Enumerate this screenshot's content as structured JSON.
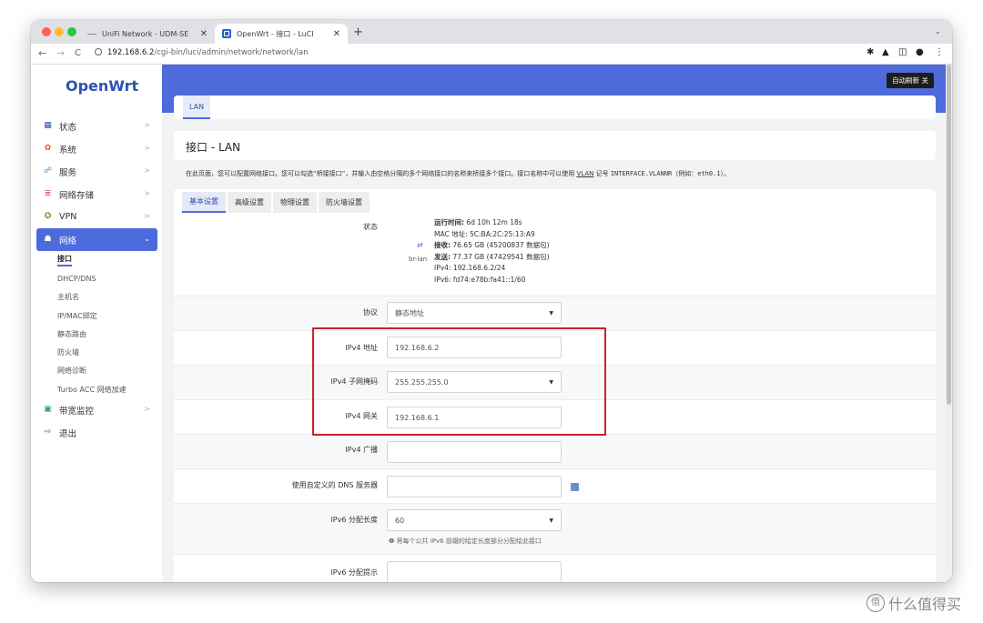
{
  "browser": {
    "tabs": [
      {
        "label": "UniFi Network - UDM-SE",
        "close": "✕"
      },
      {
        "label": "OpenWrt - 接口 - LuCI",
        "close": "✕"
      }
    ],
    "new_tab": "+",
    "tab_menu": "⌄",
    "url_host": "192.168.6.2",
    "url_path": "/cgi-bin/luci/admin/network/network/lan",
    "nav_back": "←",
    "nav_forward": "→",
    "nav_reload": "C"
  },
  "sidebar": {
    "logo": "OpenWrt",
    "items": [
      {
        "label": "状态",
        "icon": "▦",
        "color": "#2f52b0"
      },
      {
        "label": "系统",
        "icon": "✿",
        "color": "#e0502a"
      },
      {
        "label": "服务",
        "icon": "☍",
        "color": "#3a8bd0"
      },
      {
        "label": "网络存储",
        "icon": "≣",
        "color": "#d04444"
      },
      {
        "label": "VPN",
        "icon": "✪",
        "color": "#5a9a2a"
      },
      {
        "label": "网络",
        "icon": "☗",
        "color": "#ffffff"
      }
    ],
    "network_sub": [
      "接口",
      "DHCP/DNS",
      "主机名",
      "IP/MAC绑定",
      "静态路由",
      "防火墙",
      "网络诊断",
      "Turbo ACC 网络加速"
    ],
    "bottom_items": [
      {
        "label": "带宽监控",
        "icon": "▣",
        "color": "#2aa86a"
      },
      {
        "label": "退出",
        "icon": "⇨",
        "color": "#666666"
      }
    ]
  },
  "header": {
    "auto_refresh": "自动刷新 关"
  },
  "interface_tab": "LAN",
  "page_title": "接口 - LAN",
  "description": {
    "part1": "在此页面，您可以配置网络接口。您可以勾选“桥接接口”，并输入由空格分隔的多个网络接口的名称来桥接多个接口。接口名称中可以使用 ",
    "vlan": "VLAN",
    "part2": " 记号 ",
    "code1": "INTERFACE.VLANNR",
    "part3": "（例如：",
    "code2": "eth0.1",
    "part4": "）。"
  },
  "form_tabs": [
    "基本设置",
    "高级设置",
    "物理设置",
    "防火墙设置"
  ],
  "status": {
    "label": "状态",
    "icon_label": "br-lan",
    "uptime_label": "运行时间:",
    "uptime_value": " 6d 10h 12m 18s",
    "mac_label": "MAC 地址:",
    "mac_value": " 5C:BA:2C:25:13:A9",
    "rx_label": "接收:",
    "rx_value": " 76.65 GB (45200837 数据包)",
    "tx_label": "发送:",
    "tx_value": " 77.37 GB (47429541 数据包)",
    "ipv4": "IPv4: 192.168.6.2/24",
    "ipv6": "IPv6: fd74:e78b:fa41::1/60"
  },
  "fields": {
    "protocol": {
      "label": "协议",
      "value": "静态地址"
    },
    "ipv4_addr": {
      "label": "IPv4 地址",
      "value": "192.168.6.2"
    },
    "ipv4_mask": {
      "label": "IPv4 子网掩码",
      "value": "255.255.255.0"
    },
    "ipv4_gw": {
      "label": "IPv4 网关",
      "value": "192.168.6.1"
    },
    "ipv4_bcast": {
      "label": "IPv4 广播",
      "value": ""
    },
    "custom_dns": {
      "label": "使用自定义的 DNS 服务器",
      "value": ""
    },
    "ipv6_assign": {
      "label": "IPv6 分配长度",
      "value": "60",
      "hint": "❷ 将每个公共 IPv6 前缀的给定长度部分分配给此接口"
    },
    "ipv6_hint": {
      "label": "IPv6 分配提示",
      "value": ""
    }
  },
  "watermark": {
    "icon": "值",
    "text": "什么值得买"
  },
  "colors": {
    "accent": "#4e6bdc",
    "highlight": "#cc1f2a"
  }
}
